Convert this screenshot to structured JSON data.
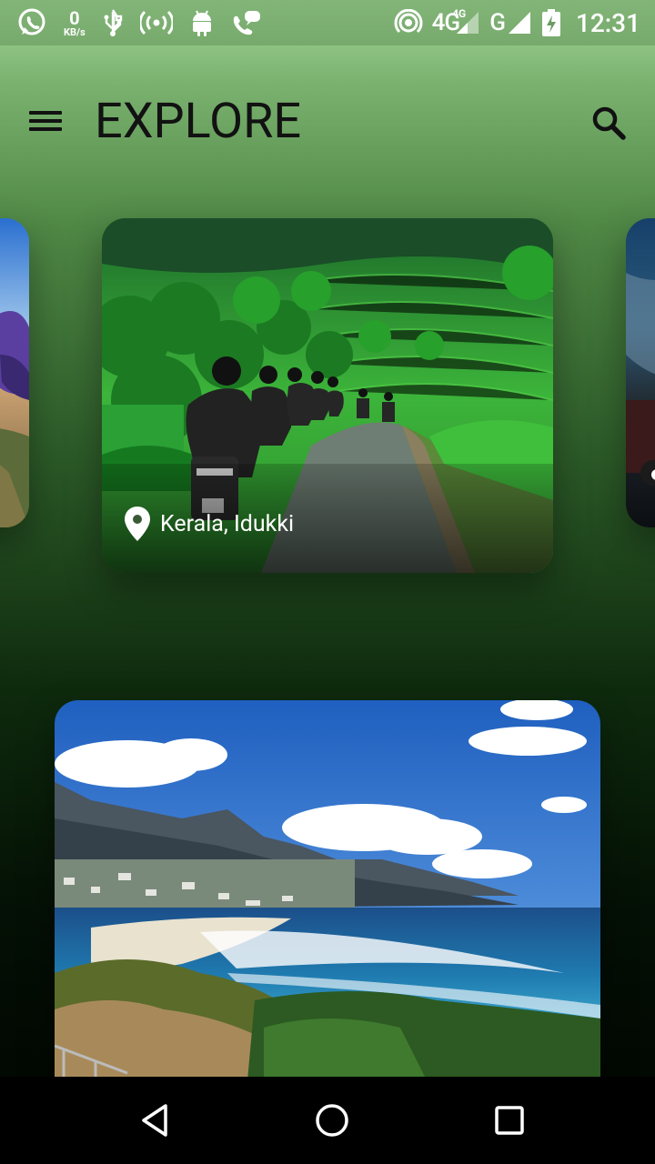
{
  "status_bar": {
    "kbs_value": "0",
    "kbs_unit": "KB/s",
    "network_1": "4G",
    "network_1_sup": "4G",
    "network_2": "G",
    "time": "12:31"
  },
  "header": {
    "title": "EXPLORE",
    "menu_icon": "hamburger-menu-icon",
    "search_icon": "search-icon"
  },
  "cards": [
    {
      "location": "Kerala, Idukki"
    }
  ],
  "colors": {
    "title": "#121212",
    "gradient_top": "#a4d79a",
    "gradient_bottom": "#020802",
    "nav_bar": "#000000"
  }
}
